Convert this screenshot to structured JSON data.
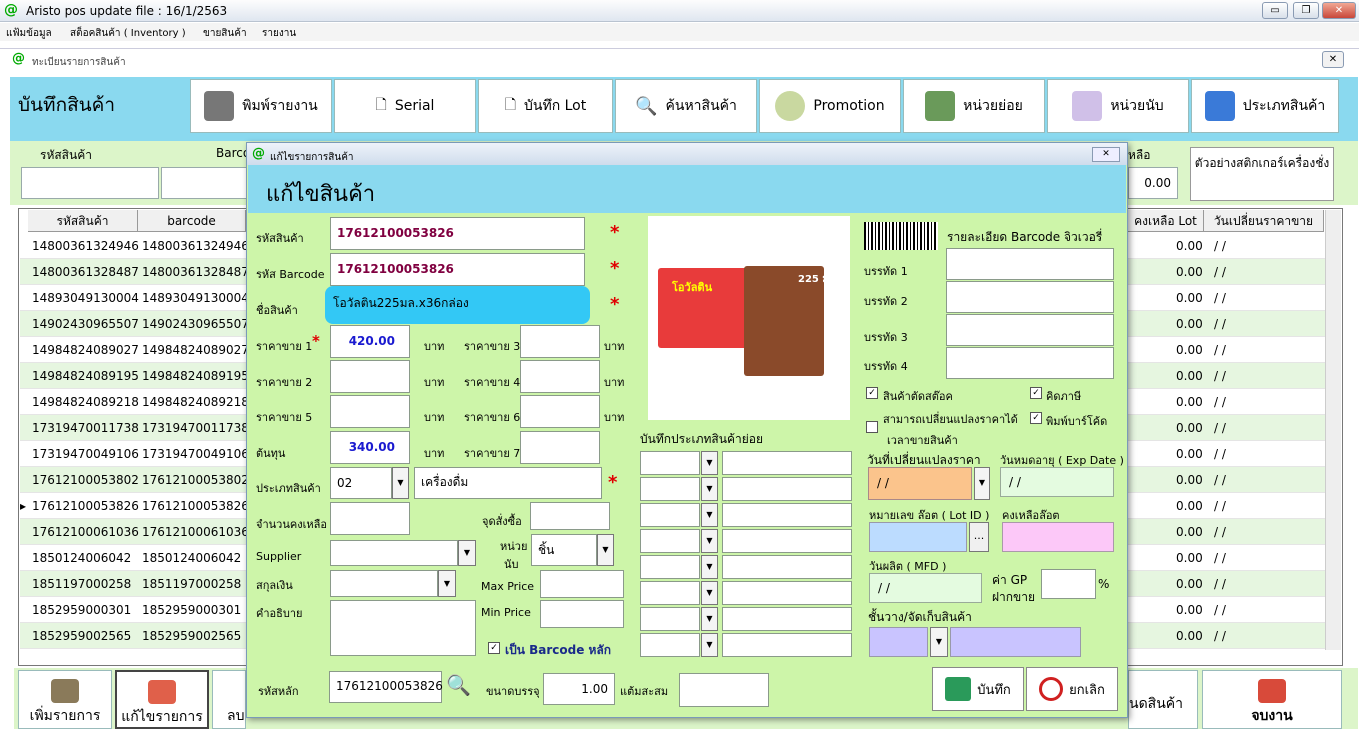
{
  "app": {
    "logo": "@",
    "title": "Aristo pos  update file : 16/1/2563"
  },
  "window_controls": {
    "minimize": "▭",
    "restore": "❐",
    "close": "✕"
  },
  "menu": [
    "แฟ้มข้อมูล",
    "สต็อคสินค้า ( Inventory )",
    "ขายสินค้า",
    "รายงาน"
  ],
  "subwindow": {
    "title": "ทะเบียนรายการสินค้า",
    "close": "✕"
  },
  "main": {
    "title": "บันทึกสินค้า",
    "toolbar": [
      "พิมพ์รายงาน",
      "Serial",
      "บันทึก Lot",
      "ค้นหาสินค้า",
      "Promotion",
      "หน่วยย่อย",
      "หน่วยนับ",
      "ประเภทสินค้า"
    ],
    "filter": {
      "code_label": "รหัสสินค้า",
      "barcode_label": "Barco",
      "remain_label": "หลือ",
      "remain_value": "0.00",
      "sticker_button": "ตัวอย่างสติกเกอร์เครื่องชั่ง"
    }
  },
  "grid": {
    "headers": [
      "รหัสสินค้า",
      "barcode",
      "คงเหลือ Lot",
      "วันเปลี่ยนราคาขาย"
    ],
    "rows": [
      [
        "14800361324946",
        "14800361324946",
        "0.00",
        "/ /"
      ],
      [
        "14800361328487",
        "14800361328487",
        "0.00",
        "/ /"
      ],
      [
        "14893049130004",
        "14893049130004",
        "0.00",
        "/ /"
      ],
      [
        "14902430965507",
        "14902430965507",
        "0.00",
        "/ /"
      ],
      [
        "14984824089027",
        "14984824089027",
        "0.00",
        "/ /"
      ],
      [
        "14984824089195",
        "14984824089195",
        "0.00",
        "/ /"
      ],
      [
        "14984824089218",
        "14984824089218",
        "0.00",
        "/ /"
      ],
      [
        "17319470011738",
        "17319470011738",
        "0.00",
        "/ /"
      ],
      [
        "17319470049106",
        "17319470049106",
        "0.00",
        "/ /"
      ],
      [
        "17612100053802",
        "17612100053802",
        "0.00",
        "/ /"
      ],
      [
        "17612100053826",
        "17612100053826",
        "0.00",
        "/ /"
      ],
      [
        "17612100061036",
        "17612100061036",
        "0.00",
        "/ /"
      ],
      [
        "1850124006042",
        "1850124006042",
        "0.00",
        "/ /"
      ],
      [
        "1851197000258",
        "1851197000258",
        "0.00",
        "/ /"
      ],
      [
        "1852959000301",
        "1852959000301",
        "0.00",
        "/ /"
      ],
      [
        "1852959002565",
        "1852959002565",
        "0.00",
        "/ /"
      ]
    ],
    "selected_marker": "▸"
  },
  "bottom": [
    "เพิ่มรายการ",
    "แก้ไขรายการ",
    "ลบ",
    "นดสินค้า",
    "จบงาน"
  ],
  "dialog": {
    "title": "แก้ไขรายการสินค้า",
    "close": "✕",
    "header": "แก้ไขสินค้า",
    "code_label": "รหัสสินค้า",
    "code": "17612100053826",
    "barcode_label": "รหัส Barcode",
    "barcode": "17612100053826",
    "name_label": "ชื่อสินค้า",
    "name": "โอวัลติน225มล.x36กล่อง",
    "price1_label": "ราคาขาย 1",
    "price1": "420.00",
    "baht": "บาท",
    "price2_label": "ราคาขาย 2",
    "price3_label": "ราคาขาย 3",
    "price4_label": "ราคาขาย 4",
    "price5_label": "ราคาขาย 5",
    "price6_label": "ราคาขาย 6",
    "price7_label": "ราคาขาย 7",
    "cost_label": "ต้นทุน",
    "cost": "340.00",
    "type_label": "ประเภทสินค้า",
    "type_code": "02",
    "type_name": "เครื่องดื่ม",
    "qty_label": "จำนวนคงเหลือ",
    "reorder_label": "จุดสั่งซื้อ",
    "supplier_label": "Supplier",
    "unit_label1": "หน่วย",
    "unit_label2": "นับ",
    "unit_value": "ชิ้น",
    "currency_label": "สกุลเงิน",
    "maxprice_label": "Max Price",
    "minprice_label": "Min Price",
    "desc_label": "คำอธิบาย",
    "main_barcode_label": "เป็น Barcode หลัก",
    "mastercode_label": "รหัสหลัก",
    "mastercode": "17612100053826",
    "packsize_label": "ขนาดบรรจุ",
    "packsize": "1.00",
    "points_label": "แต้มสะสม",
    "subtype_label": "บันทึกประเภทสินค้าย่อย",
    "jewelry_label": "รายละเอียด Barcode จิวเวอรี่",
    "line1": "บรรทัด 1",
    "line2": "บรรทัด 2",
    "line3": "บรรทัด 3",
    "line4": "บรรทัด 4",
    "cut_stock": "สินค้าตัดสต๊อค",
    "tax": "คิดภาษี",
    "change_price": "สามารถเปลี่ยนแปลงราคาได้",
    "change_price2": "เวลาขายสินค้า",
    "print_barcode": "พิมพ์บาร์โค้ด",
    "price_change_date_label": "วันที่เปลี่ยนแปลงราคา",
    "price_change_date": " / /",
    "exp_label": "วันหมดอายุ ( Exp Date )",
    "exp": " / /",
    "lot_label": "หมายเลข ล๊อต ( Lot ID )",
    "lot_btn": "...",
    "lot_remain_label": "คงเหลือล๊อต",
    "mfd_label": "วันผลิต ( MFD )",
    "mfd": " / /",
    "gp_label1": "ค่า GP",
    "gp_label2": "ฝากขาย",
    "percent": "%",
    "shelf_label": "ชั้นวาง/จัดเก็บสินค้า",
    "save": "บันทึก",
    "cancel": "ยกเลิก",
    "product_image": {
      "brand": "โอวัลติน",
      "size": "225 มล."
    }
  }
}
